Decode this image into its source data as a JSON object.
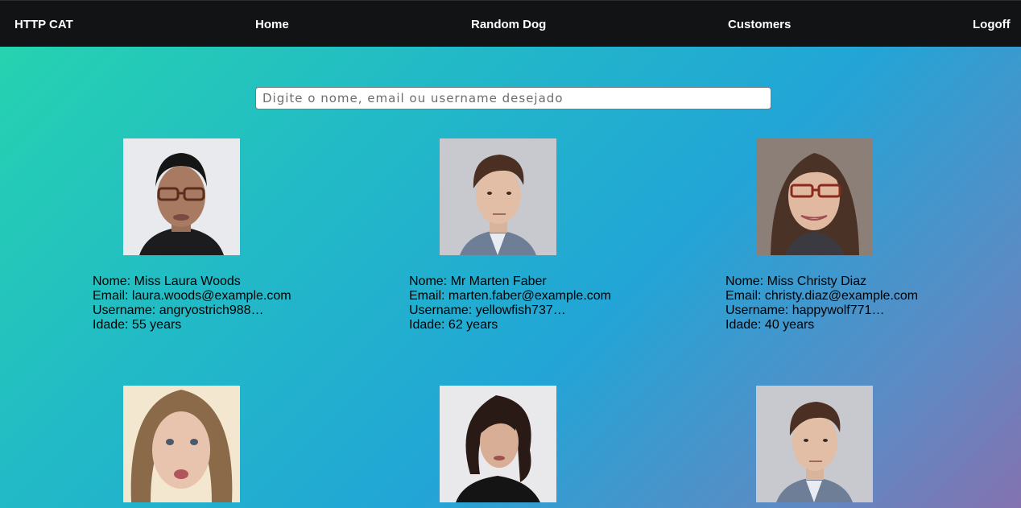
{
  "nav": {
    "brand": "HTTP CAT",
    "home": "Home",
    "random_dog": "Random Dog",
    "customers": "Customers",
    "logoff": "Logoff"
  },
  "search": {
    "placeholder": "Digite o nome, email ou username desejado",
    "value": ""
  },
  "customers": [
    {
      "name": "Nome: Miss Laura Woods",
      "email": "Email: laura.woods@example.com",
      "username": "Username: angryostrich988…",
      "age": "Idade: 55 years",
      "photo": "woman-glasses-portrait"
    },
    {
      "name": "Nome: Mr Marten Faber",
      "email": "Email: marten.faber@example.com",
      "username": "Username: yellowfish737…",
      "age": "Idade: 62 years",
      "photo": "man-suit-portrait"
    },
    {
      "name": "Nome: Miss Christy Diaz",
      "email": "Email: christy.diaz@example.com",
      "username": "Username: happywolf771…",
      "age": "Idade: 40 years",
      "photo": "woman-glasses-smiling-portrait"
    },
    {
      "photo": "woman-blonde-selfie-portrait"
    },
    {
      "photo": "woman-dark-hair-portrait"
    },
    {
      "photo": "man-suit-portrait"
    }
  ],
  "colors": {
    "navbar": "#111315",
    "nav_text": "#ffffff",
    "gradient_start": "#26d5ad",
    "gradient_mid": "#22a5d6",
    "gradient_end": "#8472b0"
  }
}
